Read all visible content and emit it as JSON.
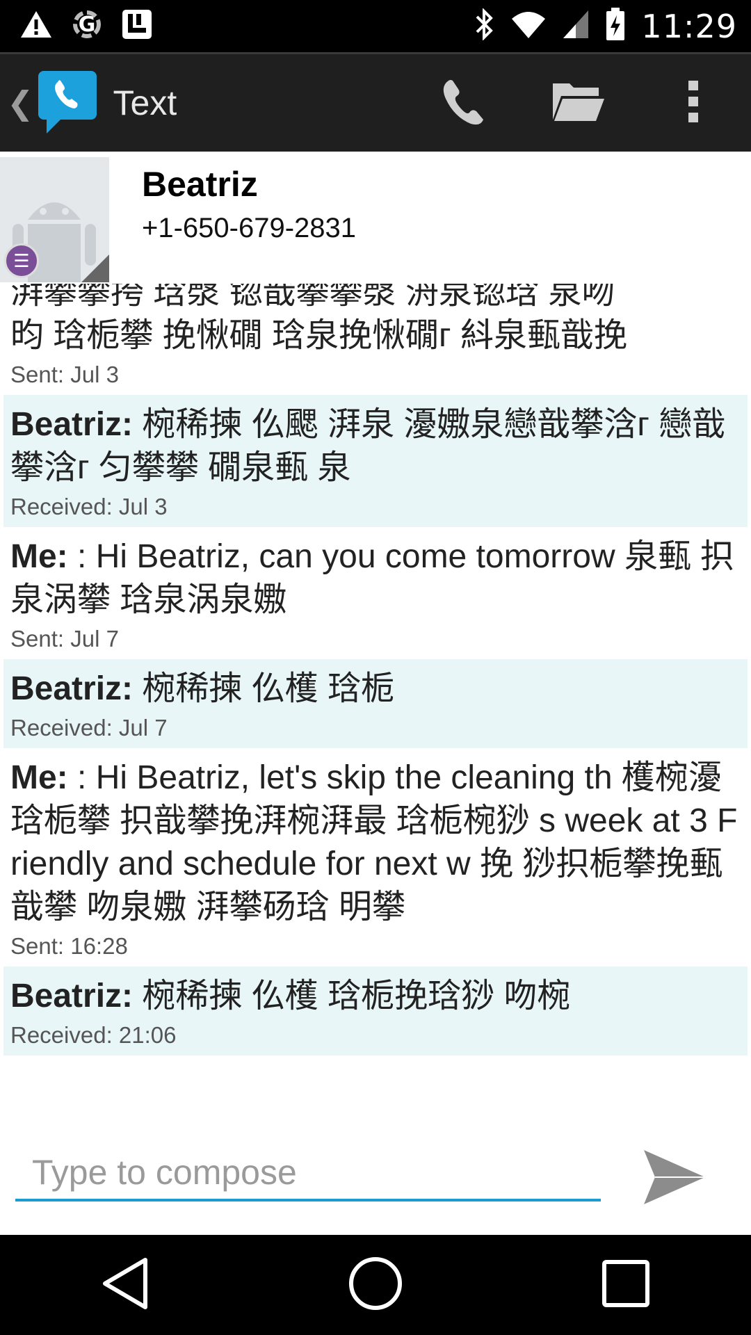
{
  "status_bar": {
    "time": "11:29",
    "icons": [
      "warning-icon",
      "sync-icon",
      "notification-icon",
      "bluetooth-icon",
      "wifi-icon",
      "signal-icon",
      "battery-icon"
    ]
  },
  "action_bar": {
    "title": "Text",
    "actions": [
      "phone-icon",
      "folder-icon",
      "overflow-menu-icon"
    ]
  },
  "contact": {
    "name": "Beatriz",
    "phone": "+1-650-679-2831"
  },
  "messages": [
    {
      "type": "sent",
      "sender": "",
      "text": "湃攀攀挎  琀漀  锪戠攀攀漀  洀泉锪琀  泉吻",
      "meta": ""
    },
    {
      "type": "sent",
      "sender": "",
      "text": "昀  琀栀攀  挽愀礀  琀泉挽愀礀ᴦ  紏泉甀戠挽",
      "meta": "Sent: Jul 3"
    },
    {
      "type": "received",
      "sender": "Beatriz:",
      "text": "椀稀揀  仫颸  湃泉  瀀嫐泉戀戠攀浛ᴦ 戀戠攀浛ᴦ  匀攀攀  礀泉甀  泉",
      "meta": "Received: Jul 3"
    },
    {
      "type": "sent",
      "sender": "Me:",
      "text": ": Hi Beatriz, can you come tomorrow 泉甀  抧泉涡攀  琀泉涡泉嫐",
      "meta": "Sent: Jul 7"
    },
    {
      "type": "received",
      "sender": "Beatriz:",
      "text": "椀稀揀  仫檴       琀栀",
      "meta": "Received: Jul 7"
    },
    {
      "type": "sent",
      "sender": "Me:",
      "text": ": Hi Beatriz, let's skip the cleaning th 檴椀瀀  琀栀攀  抧戠攀挽湃椀湃最  琀栀椀猀 s week at 3 Friendly and schedule for next w 挽  猀抧栀攀挽甀戠攀  吻泉嫐  湃攀砀琀  明攀",
      "meta": "Sent: 16:28"
    },
    {
      "type": "received",
      "sender": "Beatriz:",
      "text": "椀稀揀  仫檴  琀栀挽琀猀  吻椀",
      "meta": "Received: 21:06"
    }
  ],
  "compose": {
    "placeholder": "Type to compose"
  },
  "nav_bar": {
    "buttons": [
      "back-nav-icon",
      "home-nav-icon",
      "recents-nav-icon"
    ]
  }
}
